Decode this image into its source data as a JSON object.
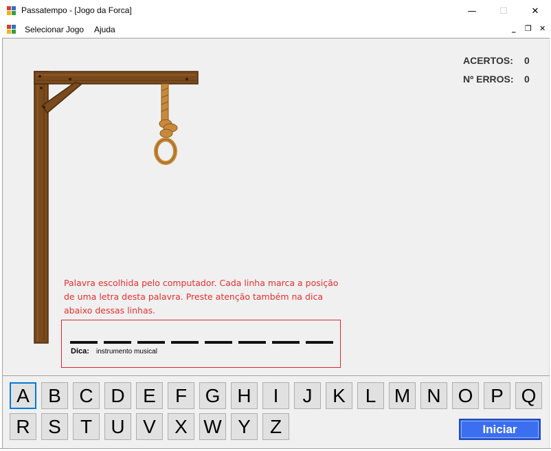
{
  "window": {
    "title": "Passatempo - [Jogo da Forca]",
    "minimize_glyph": "—",
    "maximize_glyph": "☐",
    "close_glyph": "✕"
  },
  "menu": {
    "items": [
      "Selecionar Jogo",
      "Ajuda"
    ],
    "mdi_minimize": "_",
    "mdi_restore": "❐",
    "mdi_close": "✕"
  },
  "scoreboard": {
    "hits_label": "ACERTOS:",
    "hits_value": "0",
    "errors_label": "Nº ERROS:",
    "errors_value": "0"
  },
  "instructions": {
    "line1": "Palavra escolhida pelo computador. Cada linha marca a posição",
    "line2": "de uma letra desta palavra. Preste atenção também na dica",
    "line3": "abaixo dessas linhas."
  },
  "word": {
    "slot_count": 8,
    "hint_label": "Dica:",
    "hint_value": "instrumento musical"
  },
  "keyboard": {
    "row1": [
      "A",
      "B",
      "C",
      "D",
      "E",
      "F",
      "G",
      "H",
      "I",
      "J",
      "K",
      "L",
      "M",
      "N",
      "O",
      "P",
      "Q"
    ],
    "row2": [
      "R",
      "S",
      "T",
      "U",
      "V",
      "X",
      "W",
      "Y",
      "Z"
    ],
    "focused_key": "A"
  },
  "actions": {
    "start_label": "Iniciar"
  },
  "colors": {
    "wood": "#7a4a1c",
    "wood_dark": "#4a2a0c",
    "rope": "#c88a3a",
    "instruction_text": "#e03030",
    "box_border": "#d8282f",
    "start_button": "#3c6ff0",
    "focus": "#0078d7"
  },
  "icons": {
    "app": "app-grid-icon",
    "menu": "mdi-child-icon"
  }
}
